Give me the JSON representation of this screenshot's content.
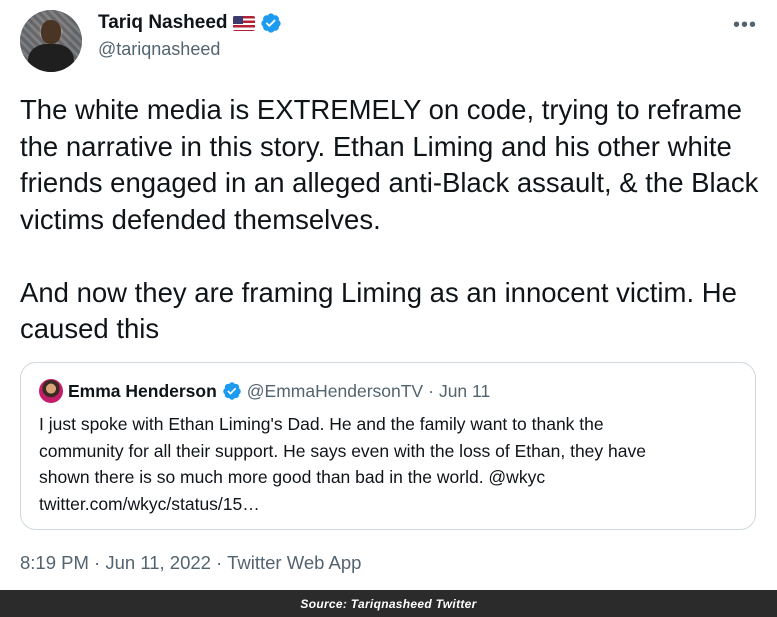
{
  "author": {
    "display_name": "Tariq Nasheed",
    "handle": "@tariqnasheed",
    "flag_icon": "us-flag-icon",
    "verified_icon": "verified-badge-icon"
  },
  "more_label": "•••",
  "tweet_text": "The white media is EXTREMELY on code, trying to reframe the narrative in this story. Ethan Liming and his other white friends engaged in an alleged anti-Black assault, & the Black victims defended themselves.\n\nAnd now they are framing Liming as an innocent victim. He caused this",
  "quote": {
    "display_name": "Emma Henderson",
    "handle": "@EmmaHendersonTV",
    "separator": "·",
    "date": "Jun 11",
    "text": "I just spoke with Ethan Liming's Dad. He and the family want to thank the\ncommunity for all their support. He says even with the loss of Ethan, they have\nshown there is so much more good than bad in the world. @wkyc\ntwitter.com/wkyc/status/15…"
  },
  "meta": {
    "time": "8:19 PM",
    "separator": "·",
    "date": "Jun 11, 2022",
    "source": "Twitter Web App"
  },
  "footer": {
    "source_label": "Source: Tariqnasheed Twitter"
  },
  "colors": {
    "text": "#0f1419",
    "secondary": "#536471",
    "verified": "#1d9bf0",
    "border": "#cfd9de",
    "footer_bg": "#2b2b2b"
  }
}
